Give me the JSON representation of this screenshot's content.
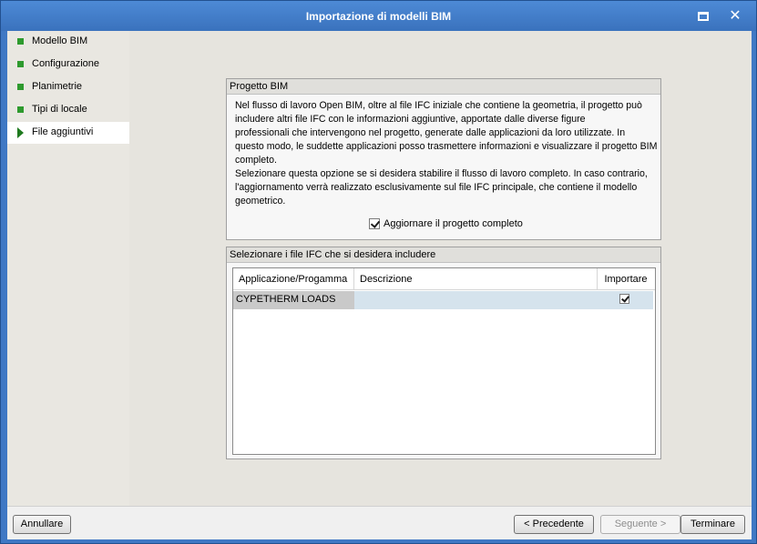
{
  "window": {
    "title": "Importazione di modelli BIM"
  },
  "sidebar": {
    "items": [
      {
        "label": "Modello BIM",
        "state": "done"
      },
      {
        "label": "Configurazione",
        "state": "done"
      },
      {
        "label": "Planimetrie",
        "state": "done"
      },
      {
        "label": "Tipi di locale",
        "state": "done"
      },
      {
        "label": "File aggiuntivi",
        "state": "current"
      }
    ]
  },
  "progetto_bim": {
    "title": "Progetto BIM",
    "lines": [
      "Nel flusso di lavoro Open BIM, oltre al file IFC iniziale che contiene la geometria, il progetto può",
      "includere altri file IFC con le informazioni aggiuntive, apportate dalle diverse figure",
      "professionali che intervengono nel progetto, generate dalle applicazioni da loro utilizzate. In",
      "questo modo, le suddette applicazioni posso trasmettere informazioni e visualizzare il progetto BIM",
      "completo.",
      "Selezionare questa opzione se si desidera stabilire il flusso di lavoro completo. In caso contrario,",
      "l'aggiornamento verrà realizzato esclusivamente sul file IFC principale, che contiene il modello",
      "geometrico."
    ],
    "checkbox_label": "Aggiornare il progetto completo",
    "checkbox_checked": true
  },
  "ifc_files": {
    "title": "Selezionare i file IFC che si desidera includere",
    "columns": [
      "Applicazione/Progamma",
      "Descrizione",
      "Importare"
    ],
    "rows": [
      {
        "app": "CYPETHERM LOADS",
        "description": "",
        "import": true
      }
    ]
  },
  "footer": {
    "cancel_label": "Annullare",
    "prev_label": "< Precedente",
    "next_label": "Seguente >",
    "finish_label": "Terminare"
  },
  "colors": {
    "titlebar": "#3f78c4",
    "step_done": "#2e9a2e",
    "row_highlight": "#d5e3ed"
  }
}
